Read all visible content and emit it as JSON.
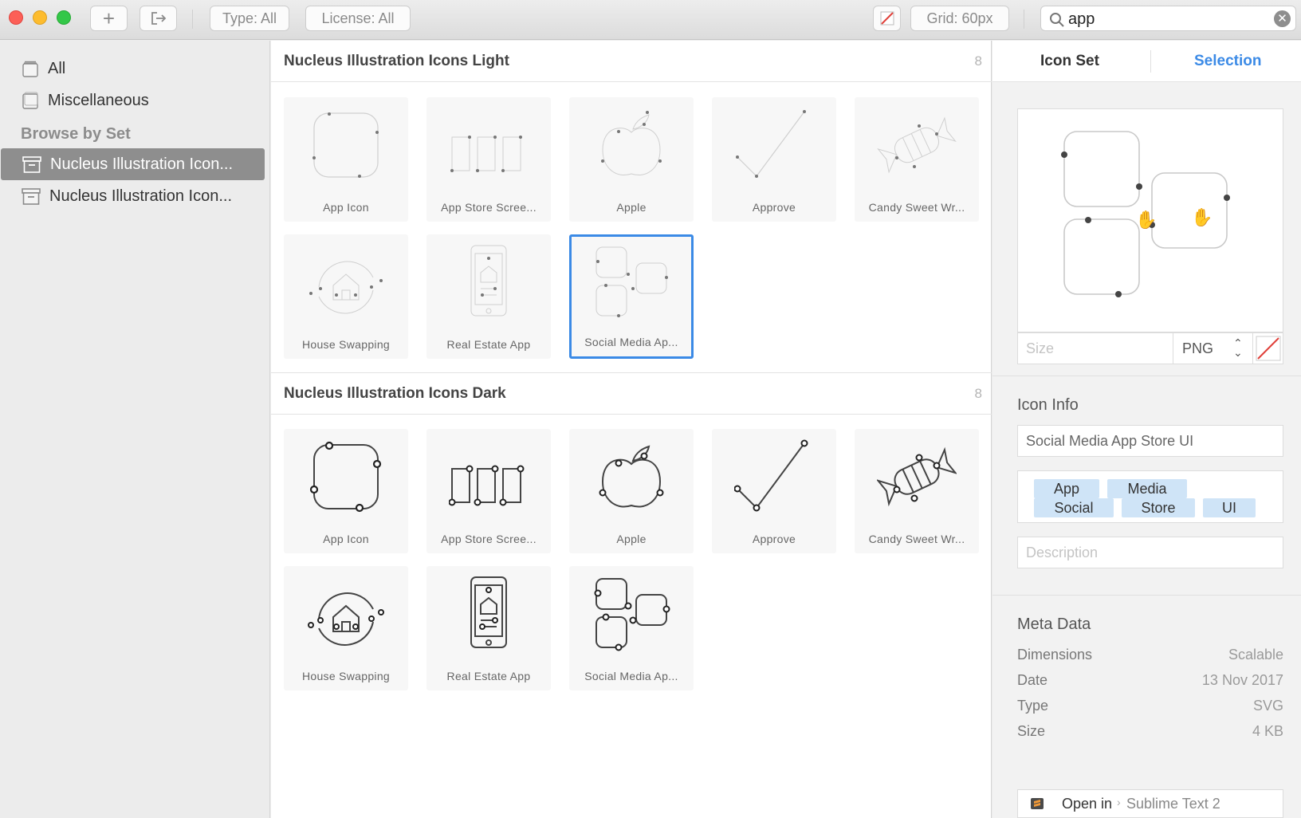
{
  "toolbar": {
    "add_label": "+",
    "type_filter": "Type: All",
    "license_filter": "License: All",
    "grid": "Grid: 60px",
    "search_value": "app"
  },
  "sidebar": {
    "items": [
      {
        "label": "All"
      },
      {
        "label": "Miscellaneous"
      }
    ],
    "browse_header": "Browse by Set",
    "sets": [
      {
        "label": "Nucleus Illustration Icon..."
      },
      {
        "label": "Nucleus Illustration Icon..."
      }
    ]
  },
  "sections": [
    {
      "title": "Nucleus Illustration Icons Light",
      "count": "8",
      "tiles": [
        "App Icon",
        "App Store Scree...",
        "Apple",
        "Approve",
        "Candy Sweet Wr...",
        "House Swapping",
        "Real Estate App",
        "Social Media Ap..."
      ]
    },
    {
      "title": "Nucleus Illustration Icons Dark",
      "count": "8",
      "tiles": [
        "App Icon",
        "App Store Scree...",
        "Apple",
        "Approve",
        "Candy Sweet Wr...",
        "House Swapping",
        "Real Estate App",
        "Social Media Ap..."
      ]
    }
  ],
  "inspector": {
    "tabs": [
      "Icon Set",
      "Selection"
    ],
    "size_placeholder": "Size",
    "format": "PNG",
    "icon_info_header": "Icon Info",
    "icon_name": "Social Media App Store UI",
    "tags": [
      "App",
      "Media",
      "Social",
      "Store",
      "UI"
    ],
    "description_placeholder": "Description",
    "meta_header": "Meta Data",
    "meta": [
      {
        "key": "Dimensions",
        "value": "Scalable"
      },
      {
        "key": "Date",
        "value": "13 Nov 2017"
      },
      {
        "key": "Type",
        "value": "SVG"
      },
      {
        "key": "Size",
        "value": "4 KB"
      }
    ],
    "open_in_label": "Open in",
    "open_in_app": "Sublime Text 2"
  },
  "colors": {
    "accent": "#3b8ae6",
    "tag_bg": "#cfe4f7",
    "sidebar_selected": "#8e8e8e"
  }
}
